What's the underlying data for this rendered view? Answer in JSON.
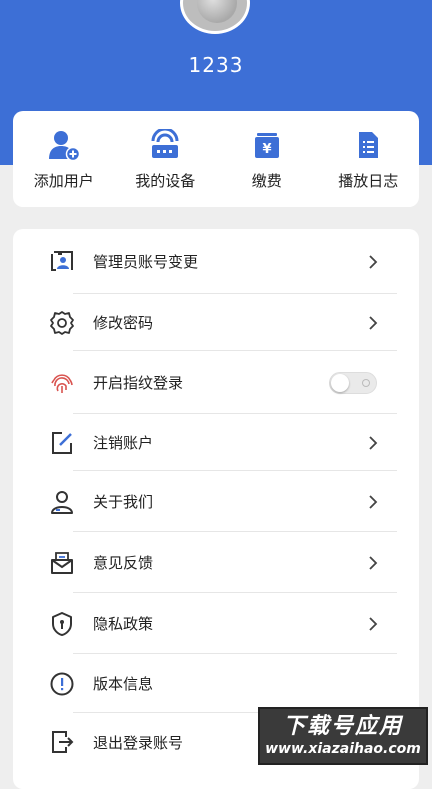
{
  "profile": {
    "username": "1233"
  },
  "quick_actions": [
    {
      "label": "添加用户",
      "icon": "add-user-icon"
    },
    {
      "label": "我的设备",
      "icon": "device-icon"
    },
    {
      "label": "缴费",
      "icon": "payment-icon"
    },
    {
      "label": "播放日志",
      "icon": "log-icon"
    }
  ],
  "menu": [
    {
      "label": "管理员账号变更",
      "icon": "admin-change-icon",
      "has_chevron": true
    },
    {
      "label": "修改密码",
      "icon": "gear-icon",
      "has_chevron": true
    },
    {
      "label": "开启指纹登录",
      "icon": "fingerprint-icon",
      "toggle": false
    },
    {
      "label": "注销账户",
      "icon": "edit-icon",
      "has_chevron": true
    },
    {
      "label": "关于我们",
      "icon": "person-icon",
      "has_chevron": true
    },
    {
      "label": "意见反馈",
      "icon": "mail-icon",
      "has_chevron": true
    },
    {
      "label": "隐私政策",
      "icon": "shield-lock-icon",
      "has_chevron": true
    },
    {
      "label": "版本信息",
      "icon": "info-icon",
      "has_chevron": false
    },
    {
      "label": "退出登录账号",
      "icon": "logout-icon",
      "has_chevron": false
    }
  ],
  "watermark": {
    "title": "下载号应用",
    "url": "www.xiazaihao.com"
  },
  "colors": {
    "primary": "#3d6fd6",
    "background": "#eeeeee",
    "fingerprint": "#d9534f"
  }
}
